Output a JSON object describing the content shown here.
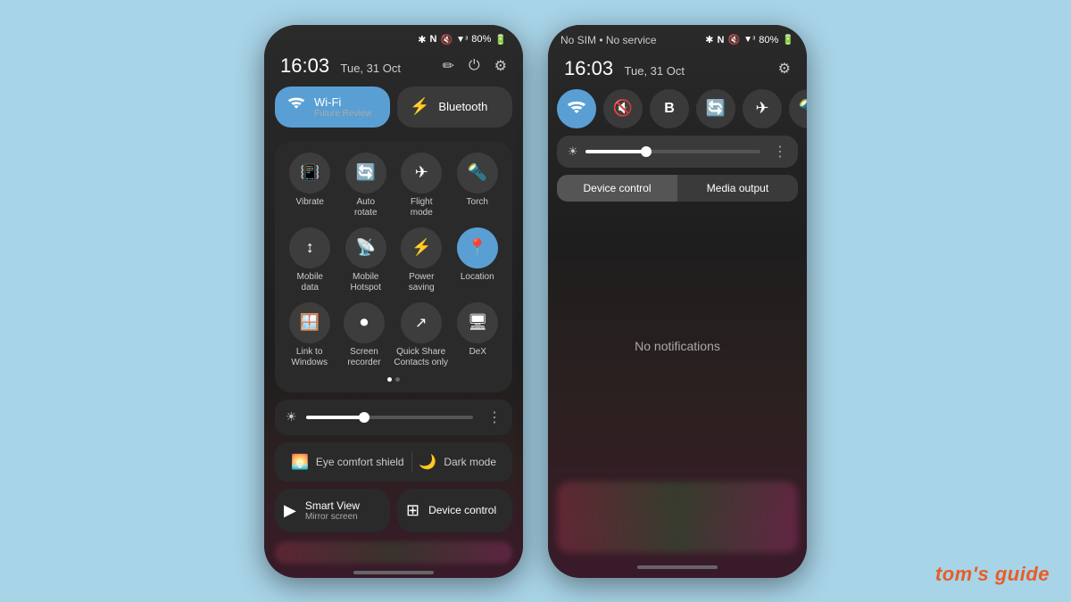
{
  "phones": {
    "left": {
      "statusBar": {
        "icons": "✱ N 🔇 ▼ ᵌ 80% 🔋",
        "battery": "80%"
      },
      "header": {
        "time": "16:03",
        "date": "Tue, 31 Oct"
      },
      "tiles": {
        "wifi": {
          "label": "Wi-Fi",
          "sublabel": "Future Review",
          "active": true
        },
        "bluetooth": {
          "label": "Bluetooth",
          "active": false
        }
      },
      "gridTiles": [
        {
          "icon": "vibrate",
          "label": "Vibrate"
        },
        {
          "icon": "rotate",
          "label": "Auto\nrotate"
        },
        {
          "icon": "flight",
          "label": "Flight\nmode"
        },
        {
          "icon": "torch",
          "label": "Torch"
        },
        {
          "icon": "mobile",
          "label": "Mobile\ndata"
        },
        {
          "icon": "hotspot",
          "label": "Mobile\nHotspot"
        },
        {
          "icon": "power",
          "label": "Power\nsaving"
        },
        {
          "icon": "location",
          "label": "Location"
        },
        {
          "icon": "link",
          "label": "Link to\nWindows"
        },
        {
          "icon": "screen",
          "label": "Screen\nrecorder"
        },
        {
          "icon": "share",
          "label": "Quick Share\nContacts only"
        },
        {
          "icon": "dex",
          "label": "DeX"
        }
      ],
      "brightness": "35",
      "eyeComfort": "Eye comfort shield",
      "darkMode": "Dark mode",
      "smartView": {
        "label": "Smart View",
        "sublabel": "Mirror screen"
      },
      "deviceControl": {
        "label": "Device control"
      }
    },
    "right": {
      "statusBar": {
        "noSim": "No SIM • No service",
        "icons": "✱ N 🔇 ▼ ᵌ 80% 🔋"
      },
      "header": {
        "time": "16:03",
        "date": "Tue, 31 Oct"
      },
      "quickIcons": [
        {
          "icon": "wifi",
          "active": true
        },
        {
          "icon": "mute",
          "active": false
        },
        {
          "icon": "bluetooth",
          "active": false
        },
        {
          "icon": "rotate",
          "active": false
        },
        {
          "icon": "flight",
          "active": false
        },
        {
          "icon": "torch",
          "active": false
        }
      ],
      "tabs": {
        "deviceControl": "Device control",
        "mediaOutput": "Media output"
      },
      "notification": "No notifications"
    }
  },
  "watermark": {
    "brand1": "tom's",
    "brand2": "guide"
  }
}
